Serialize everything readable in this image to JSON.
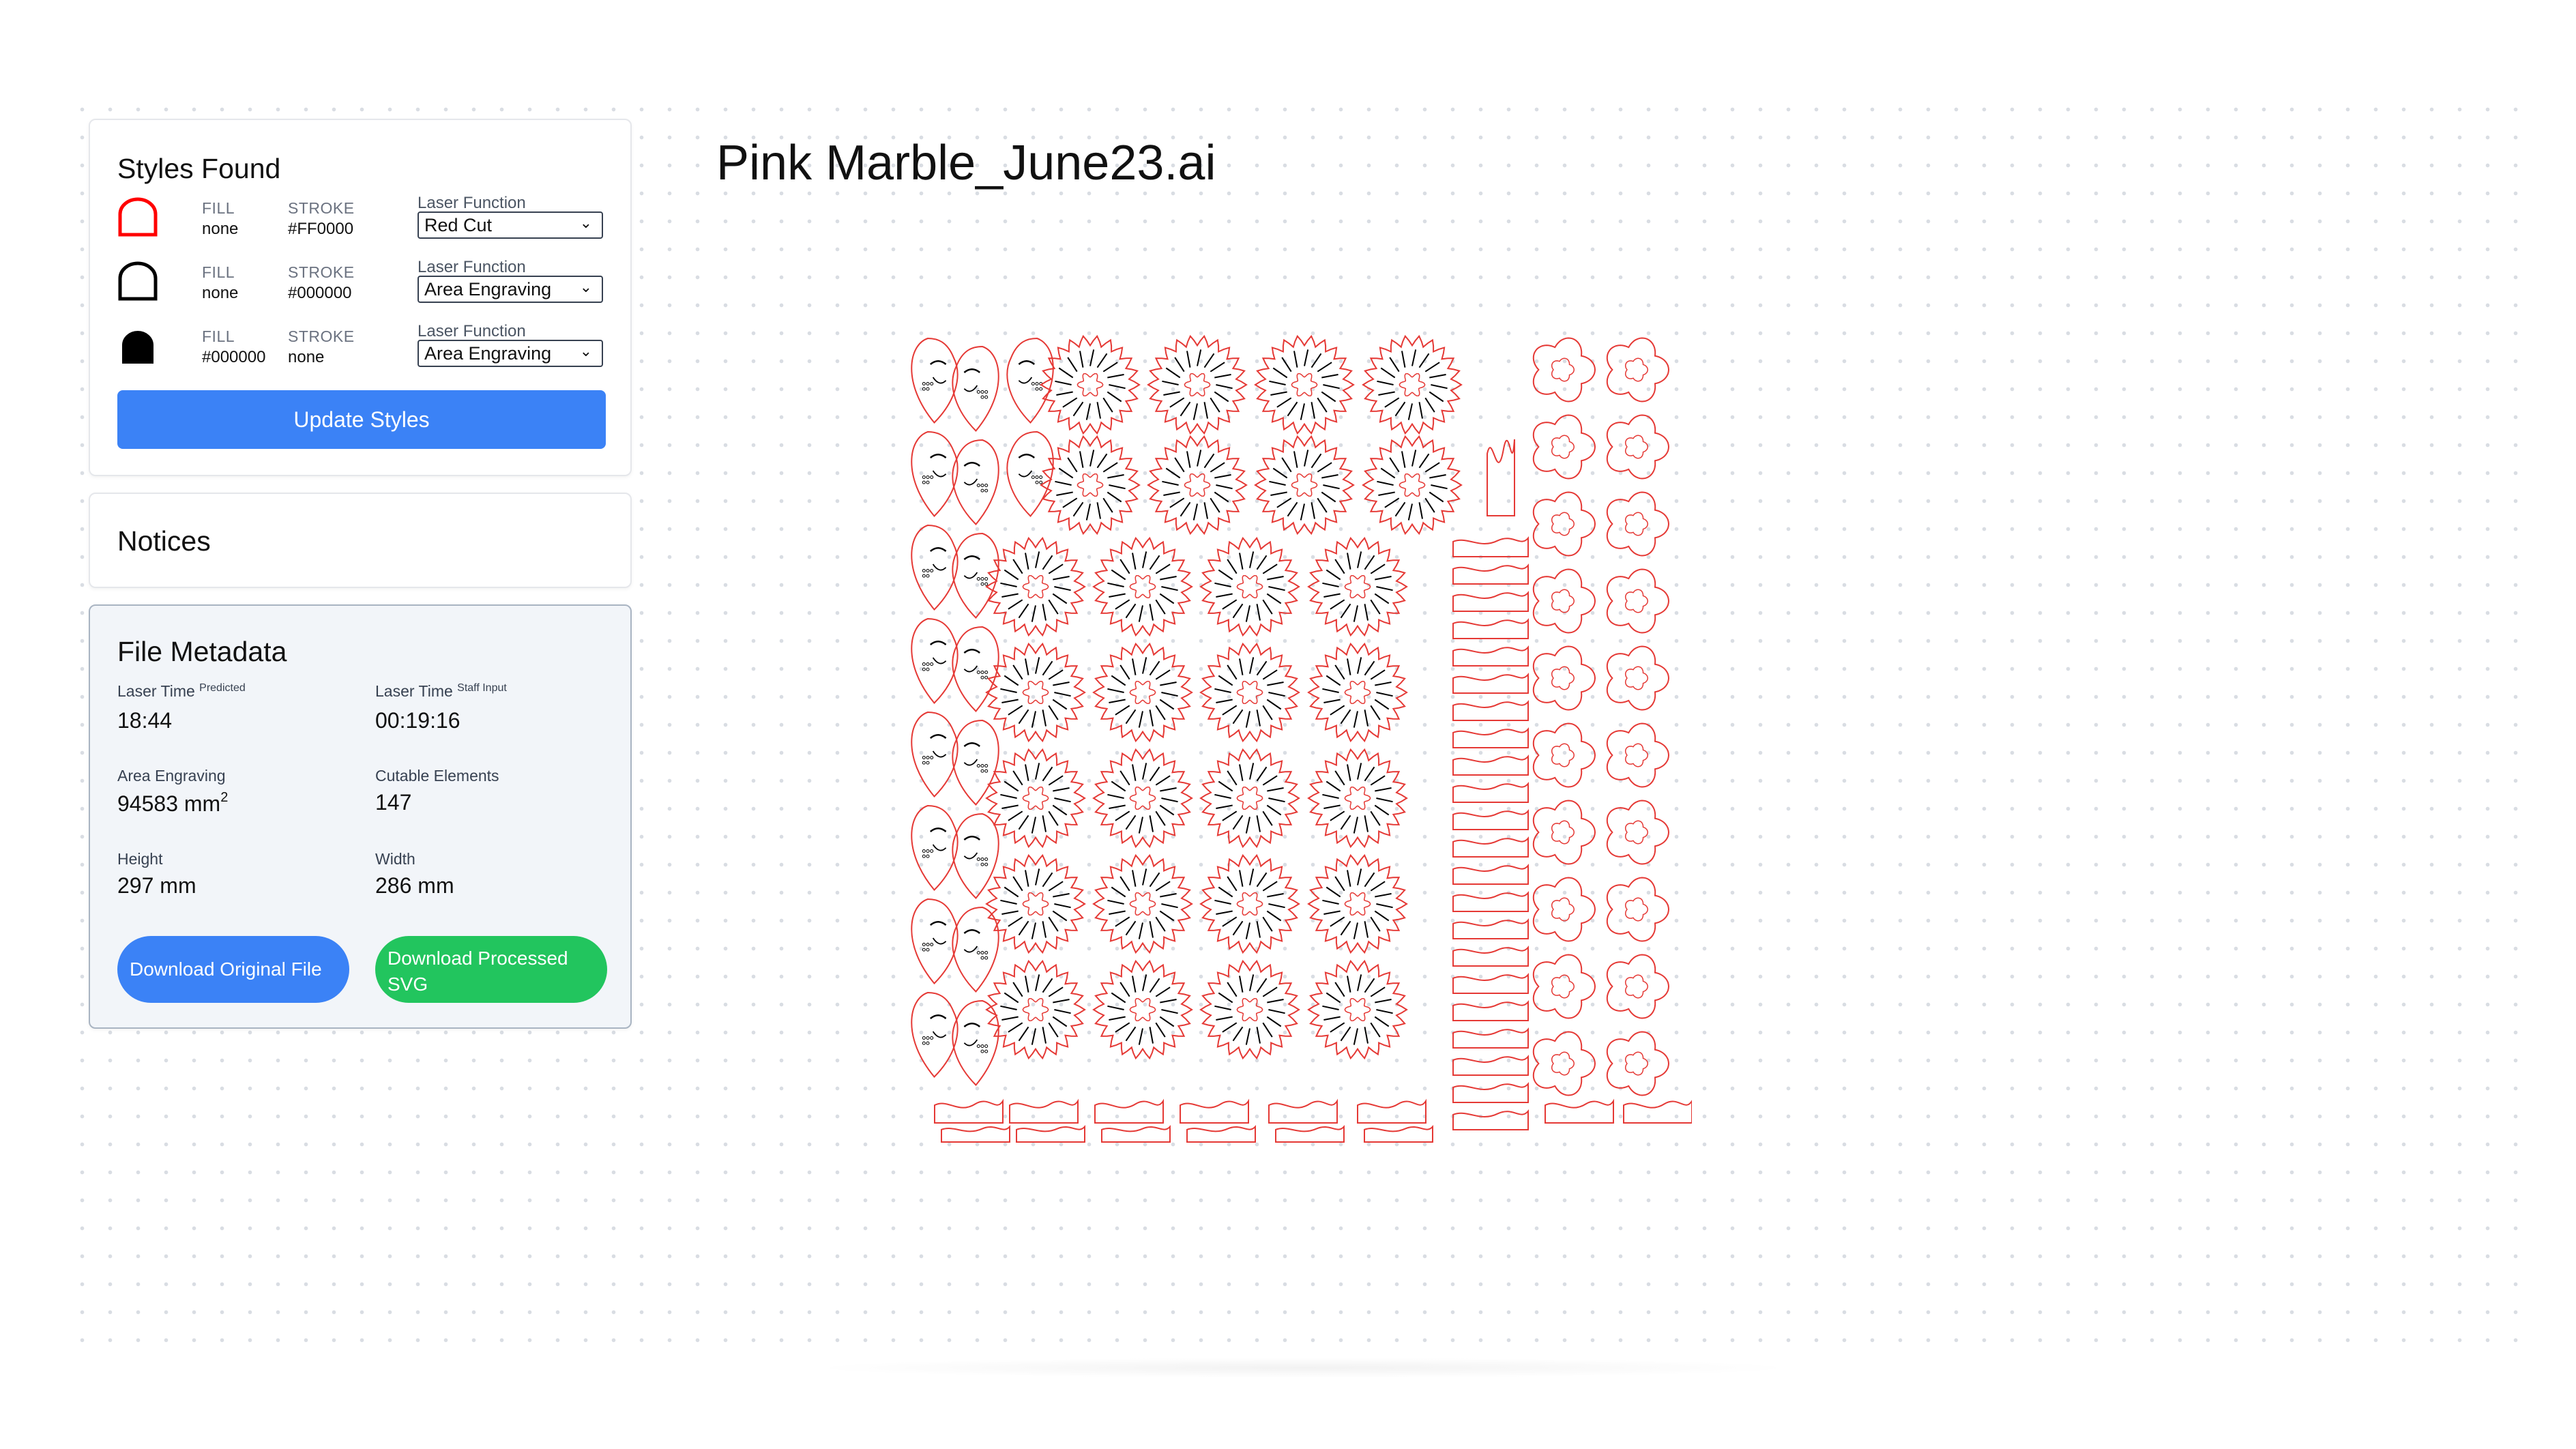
{
  "styles_panel": {
    "title": "Styles Found",
    "rows": [
      {
        "fill_label": "FILL",
        "fill": "none",
        "stroke_label": "STROKE",
        "stroke": "#FF0000",
        "laser_label": "Laser Function",
        "laser_value": "Red Cut",
        "icon": "red-outline-arch-icon",
        "swatch_color": "#FF0000"
      },
      {
        "fill_label": "FILL",
        "fill": "none",
        "stroke_label": "STROKE",
        "stroke": "#000000",
        "laser_label": "Laser Function",
        "laser_value": "Area Engraving",
        "icon": "black-outline-arch-icon",
        "swatch_color": "#000000"
      },
      {
        "fill_label": "FILL",
        "fill": "#000000",
        "stroke_label": "STROKE",
        "stroke": "none",
        "laser_label": "Laser Function",
        "laser_value": "Area Engraving",
        "icon": "black-filled-arch-icon",
        "swatch_color": "#000000"
      }
    ],
    "update_button": "Update Styles"
  },
  "notices_panel": {
    "title": "Notices"
  },
  "metadata_panel": {
    "title": "File Metadata",
    "laser_time_predicted": {
      "label": "Laser Time",
      "sup": "Predicted",
      "value": "18:44"
    },
    "laser_time_staff": {
      "label": "Laser Time",
      "sup": "Staff Input",
      "value": "00:19:16"
    },
    "area_engraving": {
      "label": "Area Engraving",
      "value": "94583 mm",
      "unit_sup": "2"
    },
    "cutable_elements": {
      "label": "Cutable Elements",
      "value": "147"
    },
    "height": {
      "label": "Height",
      "value": "297 mm"
    },
    "width": {
      "label": "Width",
      "value": "286 mm"
    },
    "download_original": "Download Original File",
    "download_processed": "Download Processed SVG"
  },
  "file_title": "Pink Marble_June23.ai",
  "colors": {
    "accent_blue": "#3b82f6",
    "success_green": "#22c55e",
    "cut_red": "#e53935",
    "engrave_black": "#000000"
  }
}
